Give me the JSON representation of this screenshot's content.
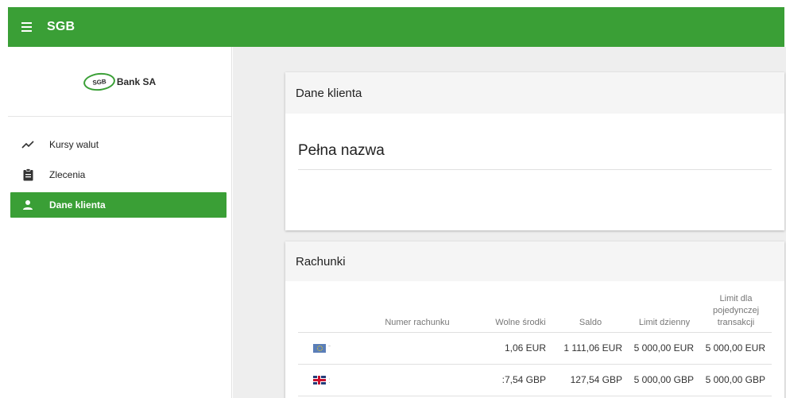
{
  "app": {
    "title": "SGB"
  },
  "logo": {
    "badge": "SGB",
    "text": "Bank SA"
  },
  "sidebar": {
    "items": [
      {
        "label": "Kursy walut",
        "icon": "trending-icon",
        "active": false
      },
      {
        "label": "Zlecenia",
        "icon": "clipboard-icon",
        "active": false
      },
      {
        "label": "Dane klienta",
        "icon": "person-icon",
        "active": true
      }
    ]
  },
  "client_card": {
    "title": "Dane klienta",
    "full_name_label": "Pełna nazwa"
  },
  "accounts_card": {
    "title": "Rachunki",
    "columns": [
      "",
      "Numer rachunku",
      "Wolne środki",
      "Saldo",
      "Limit dzienny",
      "Limit dla pojedynczej transakcji"
    ],
    "rows": [
      {
        "flag": "eu-flag-icon",
        "account": "",
        "free_funds": "1,06 EUR",
        "balance": "1 111,06 EUR",
        "daily_limit": "5 000,00 EUR",
        "single_limit": "5 000,00 EUR"
      },
      {
        "flag": "gb-flag-icon",
        "account": "",
        "free_funds": ":7,54 GBP",
        "balance": "127,54 GBP",
        "daily_limit": "5 000,00 GBP",
        "single_limit": "5 000,00 GBP"
      }
    ]
  },
  "colors": {
    "brand": "#3a9f36",
    "background": "#eeeeee"
  }
}
